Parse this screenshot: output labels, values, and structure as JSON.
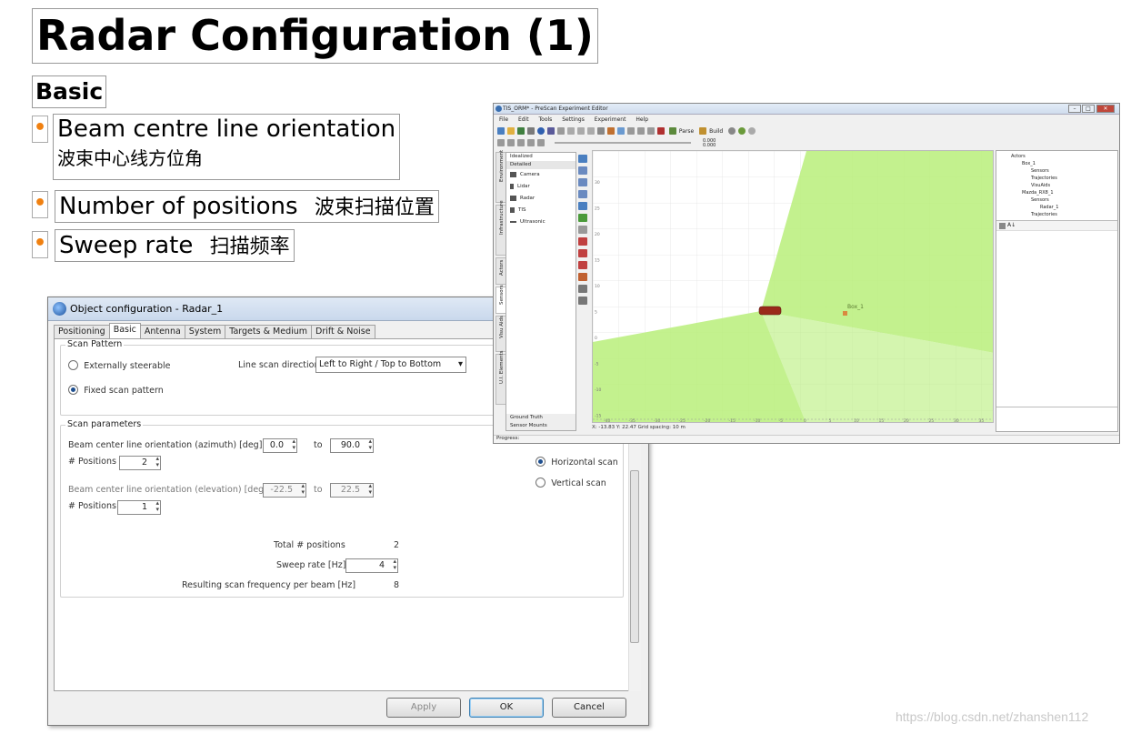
{
  "slide": {
    "title": "Radar Configuration (1)",
    "subtitle": "Basic",
    "bullets": [
      {
        "en": "Beam centre line orientation",
        "zh": "波束中心线方位角"
      },
      {
        "en": "Number of positions",
        "zh": "波束扫描位置"
      },
      {
        "en": "Sweep rate",
        "zh": "扫描频率"
      }
    ],
    "bullet_glyph": "•",
    "accent": "#f08010"
  },
  "dialog": {
    "title": "Object configuration - Radar_1",
    "tabs": [
      "Positioning",
      "Basic",
      "Antenna",
      "System",
      "Targets & Medium",
      "Drift & Noise"
    ],
    "active_tab": "Basic",
    "scan_pattern": {
      "label": "Scan Pattern",
      "externally_steerable": "Externally steerable",
      "fixed_scan": "Fixed scan pattern",
      "line_scan_label": "Line scan direction",
      "line_scan_value": "Left to Right / Top to Bottom"
    },
    "scan_params": {
      "label": "Scan parameters",
      "azimuth_label": "Beam center line orientation (azimuth) [deg]   from",
      "azimuth_from": "0.0",
      "to_label": "to",
      "azimuth_to": "90.0",
      "positions_label": "# Positions",
      "azimuth_positions": "2",
      "elevation_label": "Beam center line orientation (elevation) [deg] from",
      "elevation_from": "-22.5",
      "elevation_to": "22.5",
      "elevation_positions": "1",
      "horizontal_scan": "Horizontal scan",
      "vertical_scan": "Vertical scan",
      "total_positions_label": "Total # positions",
      "total_positions": "2",
      "sweep_rate_label": "Sweep rate [Hz]",
      "sweep_rate": "4",
      "resulting_label": "Resulting scan frequency per beam [Hz]",
      "resulting": "8"
    },
    "buttons": {
      "apply": "Apply",
      "ok": "OK",
      "cancel": "Cancel"
    }
  },
  "prescan": {
    "title": "TIS_ORM* - PreScan Experiment Editor",
    "menu": [
      "File",
      "Edit",
      "Tools",
      "Settings",
      "Experiment",
      "Help"
    ],
    "toolbar": {
      "parse": "Parse",
      "build": "Build",
      "readout_1": "0.000",
      "readout_2": "0.000"
    },
    "side_tabs": [
      "Environment",
      "Infrastructure",
      "Actors",
      "Sensors",
      "Visu Aids",
      "U.I. Elements"
    ],
    "library": {
      "header_1": "Idealized",
      "header_2": "Detailed",
      "items": [
        "Camera",
        "Lidar",
        "Radar",
        "TIS",
        "Ultrasonic"
      ],
      "footer_1": "Ground Truth",
      "footer_2": "Sensor Mounts"
    },
    "canvas": {
      "object_label": "Box_1",
      "status": "X: -13.83   Y: 22.47   Grid spacing: 10 m",
      "beam_color": "#b8ee7a",
      "y_ticks": [
        "30",
        "25",
        "20",
        "15",
        "10",
        "5",
        "0",
        "-5",
        "-10",
        "-15"
      ],
      "x_ticks": [
        "-40",
        "-35",
        "-30",
        "-25",
        "-20",
        "-15",
        "-10",
        "-5",
        "0",
        "5",
        "10",
        "15",
        "20",
        "25",
        "30",
        "35",
        "40"
      ]
    },
    "tree": [
      "Actors",
      "Box_1",
      "Sensors",
      "Trajectories",
      "VisuAids",
      "Mazda_RX8_1",
      "Sensors",
      "Radar_1",
      "Trajectories"
    ],
    "progress_label": "Progress:"
  },
  "watermark": "https://blog.csdn.net/zhanshen112"
}
